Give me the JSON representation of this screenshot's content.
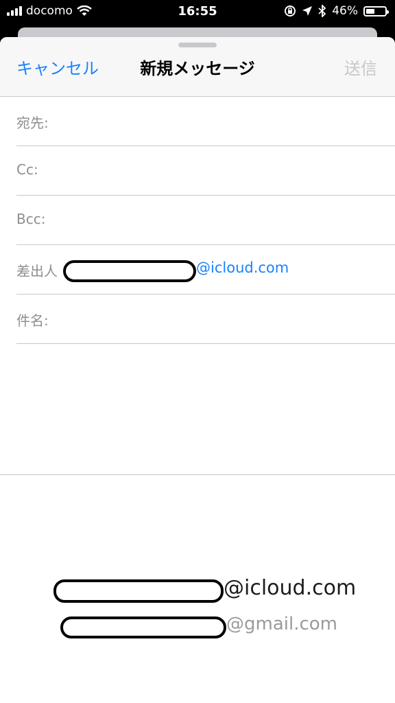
{
  "status_bar": {
    "carrier": "docomo",
    "time": "16:55",
    "battery_percent": "46%",
    "battery_level": 0.46,
    "icons": [
      "signal-icon",
      "wifi-icon",
      "orientation-lock-icon",
      "location-icon",
      "bluetooth-icon",
      "battery-icon"
    ]
  },
  "header": {
    "cancel_label": "キャンセル",
    "title": "新規メッセージ",
    "send_label": "送信"
  },
  "fields": {
    "to_label": "宛先:",
    "cc_label": "Cc:",
    "bcc_label": "Bcc:",
    "from_label": "差出人",
    "from_domain": "@icloud.com",
    "subject_label": "件名:"
  },
  "account_picker": {
    "primary_domain": "@icloud.com",
    "secondary_domain": "@gmail.com"
  },
  "colors": {
    "accent": "#1a82fb",
    "disabled": "#c7c7cc",
    "label": "#8e8e93"
  }
}
